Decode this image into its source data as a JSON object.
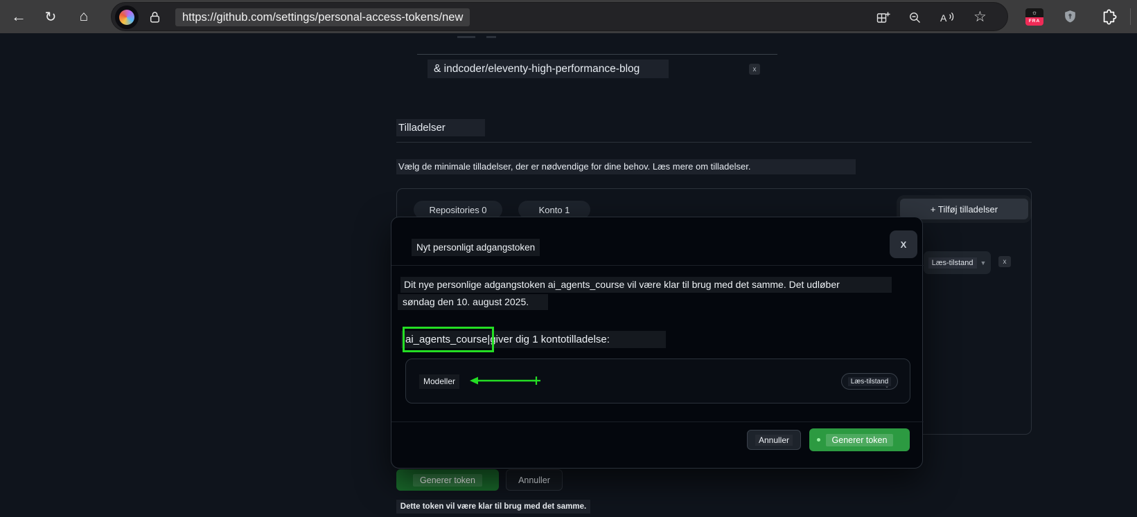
{
  "browser": {
    "url": "https://github.com/settings/personal-access-tokens/new",
    "extension_badge": "FRA"
  },
  "page": {
    "repo_row": {
      "text": "& indcoder/eleventy-high-performance-blog",
      "remove_label": "x"
    },
    "heading": "Tilladelser",
    "description": "Vælg de minimale tilladelser, der er nødvendige for dine behov. Læs mere om tilladelser.",
    "tabs": [
      {
        "label": "Repositories 0"
      },
      {
        "label": "Konto 1"
      }
    ],
    "add_permissions_button": "+ Tilføj tilladelser",
    "account_permission": {
      "dropdown_label": "Læs-tilstand",
      "remove_label": "x"
    },
    "footer": {
      "generate_button": "Generer token",
      "cancel_button": "Annuller",
      "note": "Dette token vil være klar til brug med det samme."
    }
  },
  "modal": {
    "title": "Nyt personligt adgangstoken",
    "close_button": "X",
    "body_line1": "Dit nye personlige adgangstoken ai_agents_course vil være klar til brug med det samme. Det udløber",
    "body_line2": "søndag den 10. august 2025.",
    "token_highlight": "ai_agents_course|",
    "summary_rest": "giver dig 1 kontotilladelse:",
    "permission_row": {
      "name": "Modeller",
      "level": "Læs-tilstand"
    },
    "footer": {
      "cancel_button": "Annuller",
      "generate_button": "Generer token"
    }
  },
  "colors": {
    "annotation_green": "#24dd24",
    "primary_green": "#2c9a41",
    "dimmed_green": "#1a6b2c",
    "toolbar_gray": "#3c3c3d",
    "page_bg": "#0f141c",
    "modal_bg": "#04070d"
  }
}
